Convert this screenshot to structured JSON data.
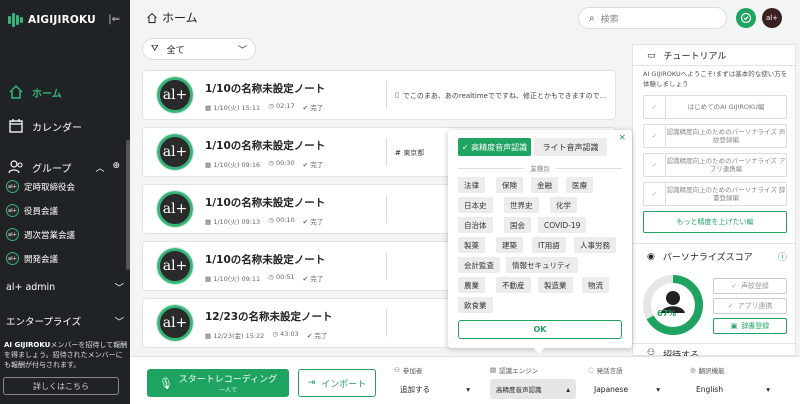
{
  "sidebar": {
    "logo_text": "AIGIJIROKU",
    "nav": {
      "home": "ホーム",
      "calendar": "カレンダー",
      "group": "グループ"
    },
    "groups": [
      "定時取締役会",
      "役員会議",
      "週次営業会議",
      "開発会議"
    ],
    "avatar_text": "al+",
    "sections": {
      "admin": "al+ admin",
      "enterprise": "エンタープライズ"
    },
    "invite": {
      "lead": "AI GIJIROKU",
      "text": "メンバーを招待して報酬を得ましょう。招待されたメンバーにも報酬が付与されます。"
    },
    "detail_button": "詳しくはこちら"
  },
  "header": {
    "title": "ホーム",
    "search_placeholder": "検索",
    "user_initials": "al+"
  },
  "filter": {
    "label": "全て"
  },
  "notes": [
    {
      "title": "1/10の名称未設定ノート",
      "date": "1/10(火) 15:11",
      "duration": "02:17",
      "status": "完了",
      "snippet": "でこのまあ、あのrealtimeでですね、修正とかもできますので..."
    },
    {
      "title": "1/10の名称未設定ノート",
      "date": "1/10(火) 09:16",
      "duration": "00:30",
      "status": "完了",
      "tag": "東京都"
    },
    {
      "title": "1/10の名称未設定ノート",
      "date": "1/10(火) 09:13",
      "duration": "00:10",
      "status": "完了"
    },
    {
      "title": "1/10の名称未設定ノート",
      "date": "1/10(火) 09:11",
      "duration": "00:51",
      "status": "完了"
    },
    {
      "title": "12/23の名称未設定ノート",
      "date": "12/23(金) 15:22",
      "duration": "43:03",
      "status": "完了"
    }
  ],
  "popup": {
    "tab_high": "高精度音声認識",
    "tab_light": "ライト音声認識",
    "industry_label": "業種別",
    "chips": [
      "法律",
      "保険",
      "金融",
      "医療",
      "日本史",
      "世界史",
      "化学",
      "自治体",
      "国会",
      "COVID-19",
      "製薬",
      "建築",
      "IT用語",
      "人事労務",
      "会計監査",
      "情報セキュリティ",
      "農業",
      "不動産",
      "製造業",
      "物流",
      "飲食業"
    ],
    "ok": "OK"
  },
  "tutorial": {
    "title": "チュートリアル",
    "intro": "AI GIJIROKUへようこそ!まずは基本的な使い方を体験しましょう",
    "steps": [
      "はじめてのAI GIJIROKU編",
      "認識精度向上のためのパーソナライズ 声紋登録編",
      "認識精度向上のためのパーソナライズ アプリ連携編",
      "認識精度向上のためのパーソナライズ 辞書登録編"
    ],
    "more": "もっと精度を上げたい編"
  },
  "personalize": {
    "title": "パーソナライズスコア",
    "percent": 67,
    "percent_label": "67%",
    "buttons": [
      "声紋登録",
      "アプリ連携",
      "辞書登録"
    ]
  },
  "invite_section": "招待する",
  "footer": {
    "record": "スタートレコーディング",
    "record_sub": "一人で",
    "import": "インポート",
    "participants_label": "参加者",
    "participants_value": "追加する",
    "engine_label": "認識エンジン",
    "engine_value": "高精度音声認識",
    "lang_label": "発話言語",
    "lang_value": "Japanese",
    "trans_label": "翻訳機能",
    "trans_value": "English"
  },
  "colors": {
    "accent": "#1ea360",
    "sidebar_bg": "#202325",
    "active_nav": "#35b577"
  }
}
